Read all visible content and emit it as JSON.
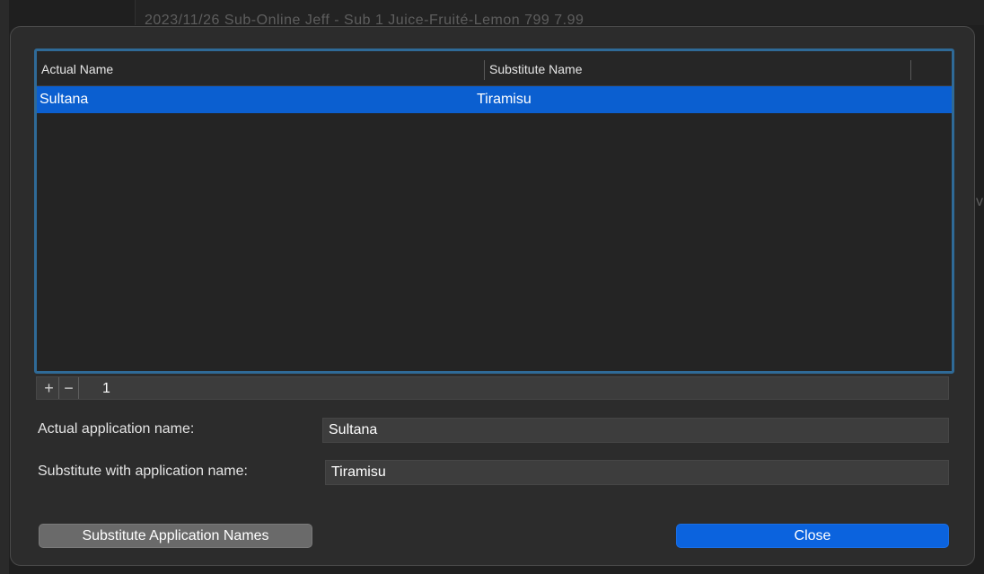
{
  "background": {
    "row_text": "2023/11/26     Sub-Online      Jeff - Sub       1          Juice-Fruité-Lemon    799   7.99",
    "edge_char": "v"
  },
  "table": {
    "columns": [
      "Actual Name",
      "Substitute Name"
    ],
    "rows": [
      {
        "actual": "Sultana",
        "substitute": "Tiramisu",
        "selected": true
      }
    ]
  },
  "footer": {
    "add_icon": "+",
    "remove_icon": "−",
    "count": "1"
  },
  "form": {
    "actual_label": "Actual application name:",
    "actual_value": "Sultana",
    "substitute_label": "Substitute with application name:",
    "substitute_value": "Tiramisu"
  },
  "buttons": {
    "substitute": "Substitute Application Names",
    "close": "Close"
  },
  "colors": {
    "selection": "#0b5fd0",
    "focus_ring": "#2f6a97",
    "default_button": "#0b63de"
  }
}
